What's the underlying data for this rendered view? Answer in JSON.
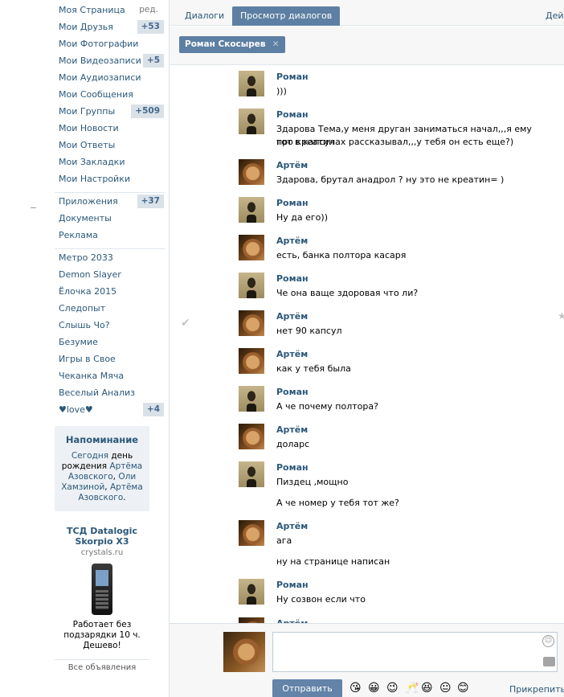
{
  "sidebar": {
    "edit_label": "ред.",
    "items": [
      {
        "label": "Моя Страница",
        "count": ""
      },
      {
        "label": "Мои Друзья",
        "count": "+53"
      },
      {
        "label": "Мои Фотографии",
        "count": ""
      },
      {
        "label": "Мои Видеозаписи",
        "count": "+5"
      },
      {
        "label": "Мои Аудиозаписи",
        "count": ""
      },
      {
        "label": "Мои Сообщения",
        "count": ""
      },
      {
        "label": "Мои Группы",
        "count": "+509"
      },
      {
        "label": "Мои Новости",
        "count": ""
      },
      {
        "label": "Мои Ответы",
        "count": ""
      },
      {
        "label": "Мои Закладки",
        "count": ""
      },
      {
        "label": "Мои Настройки",
        "count": ""
      }
    ],
    "services": [
      {
        "label": "Приложения",
        "count": "+37"
      },
      {
        "label": "Документы",
        "count": ""
      },
      {
        "label": "Реклама",
        "count": ""
      }
    ],
    "apps": [
      {
        "label": "Метро 2033",
        "count": ""
      },
      {
        "label": "Demon Slayer",
        "count": ""
      },
      {
        "label": "Ёлочка 2015",
        "count": ""
      },
      {
        "label": "Следопыт",
        "count": ""
      },
      {
        "label": "Слышь Чо?",
        "count": ""
      },
      {
        "label": "Безумие",
        "count": ""
      },
      {
        "label": "Игры в Свое",
        "count": ""
      },
      {
        "label": "Чеканка Мяча",
        "count": ""
      },
      {
        "label": "Веселый Анализ",
        "count": ""
      },
      {
        "label": "♥love♥",
        "count": "+4"
      }
    ]
  },
  "reminder": {
    "title": "Напоминание",
    "today": "Сегодня",
    "text1": " день рождения ",
    "person1": "Артёма Азовского",
    "sep1": ", ",
    "person2": "Оли Хамзиной",
    "sep2": ", ",
    "person3": "Артёма Азовского",
    "end": "."
  },
  "ad": {
    "title": "ТСД Datalogic Skorpio X3",
    "domain": "crystals.ru",
    "text": "Работает без подзарядки 10 ч. Дешево!",
    "all_ads": "Все объявления"
  },
  "tabs": [
    {
      "label": "Диалоги"
    },
    {
      "label": "Просмотр диалогов"
    },
    {
      "label": "Дейс"
    }
  ],
  "peer": {
    "name": "Роман Скосырев",
    "close": "✕"
  },
  "messages": [
    {
      "author": "Роман",
      "avatar": "roman",
      "lines": [
        ")))"
      ]
    },
    {
      "author": "Роман",
      "avatar": "roman",
      "lines": [
        "Здарова Тема,у меня друган заниматься начал,,,я ему про креатин",
        "тот в капсулах рассказывал,,,у тебя он есть еще?)"
      ]
    },
    {
      "author": "Артём",
      "avatar": "artem",
      "lines": [
        "Здарова, брутал анадрол ? ну это не креатин= )"
      ]
    },
    {
      "author": "Роман",
      "avatar": "roman",
      "lines": [
        "Ну да его))"
      ]
    },
    {
      "author": "Артём",
      "avatar": "artem",
      "lines": [
        "есть, банка полтора касаря"
      ]
    },
    {
      "author": "Роман",
      "avatar": "roman",
      "lines": [
        "Че она ваще здоровая что ли?"
      ]
    },
    {
      "author": "Артём",
      "avatar": "artem",
      "lines": [
        "нет 90 капсул"
      ]
    },
    {
      "author": "Артём",
      "avatar": "artem",
      "lines": [
        "как у тебя была"
      ]
    },
    {
      "author": "Роман",
      "avatar": "roman",
      "lines": [
        "А че почему полтора?"
      ]
    },
    {
      "author": "Артём",
      "avatar": "artem",
      "lines": [
        "доларс"
      ]
    },
    {
      "author": "Роман",
      "avatar": "roman",
      "lines": [
        "Пиздец ,мощно",
        "",
        "А че номер у тебя тот же?"
      ]
    },
    {
      "author": "Артём",
      "avatar": "artem",
      "lines": [
        "ага",
        "",
        "ну на странице написан"
      ]
    },
    {
      "author": "Роман",
      "avatar": "roman",
      "lines": [
        "Ну созвон если что"
      ]
    },
    {
      "author": "Артём",
      "avatar": "artem",
      "lines": []
    }
  ],
  "compose": {
    "placeholder": "",
    "send_label": "Отправить",
    "attach_label": "Прикрепить",
    "emoji": [
      "😘",
      "😀",
      "😉",
      "🥂",
      "😆",
      "😐",
      "😊"
    ]
  }
}
